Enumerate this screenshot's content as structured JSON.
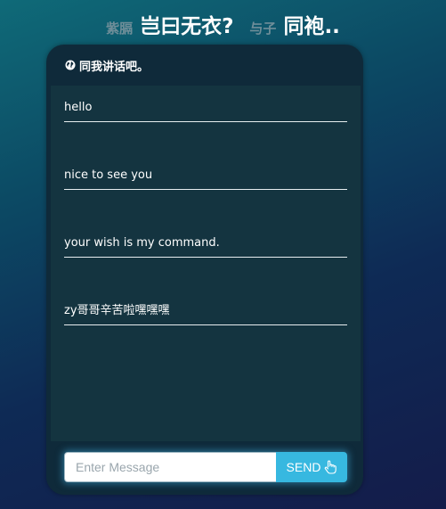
{
  "header": {
    "name_a": "紫膈",
    "line_a": "岂曰无衣?",
    "name_b": "与子",
    "line_b": "同袍.."
  },
  "chat": {
    "title": "同我讲话吧。",
    "title_icon": "globe-icon",
    "messages": [
      "hello",
      "nice to see you",
      "your wish is my command.",
      "zy哥哥辛苦啦嘿嘿嘿"
    ],
    "input": {
      "placeholder": "Enter Message",
      "value": ""
    },
    "send_label": "SEND",
    "send_icon": "pointer-hand-icon"
  },
  "colors": {
    "card": "#0f2a3a",
    "message_area": "#143440",
    "send_button": "#37b8e0"
  }
}
